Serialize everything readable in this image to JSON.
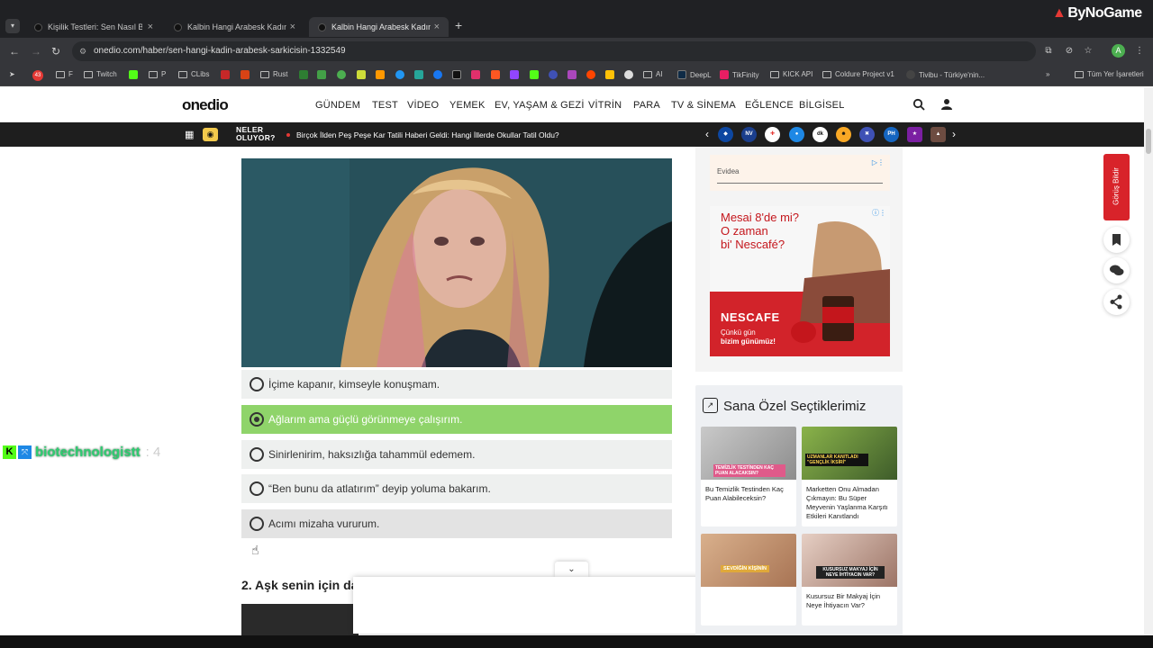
{
  "browser": {
    "tabs": [
      {
        "title": "Kişilik Testleri: Sen Nasıl Birisin?"
      },
      {
        "title": "Kalbin Hangi Arabesk Kadın Şa"
      },
      {
        "title": "Kalbin Hangi Arabesk Kadın Şa"
      }
    ],
    "url": "onedio.com/haber/sen-hangi-kadin-arabesk-sarkicisin-1332549",
    "avatar_letter": "A",
    "brand_overlay": "ByNoGame",
    "bookmarks": [
      "F",
      "Twitch",
      "P",
      "CLibs",
      "Rust",
      "AI",
      "DeepL",
      "TikFinity",
      "KICK API",
      "Coldure Project v1",
      "Tivibu - Türkiye'nin...",
      "Tüm Yer İşaretleri"
    ],
    "bookmark_badge": "43"
  },
  "site": {
    "logo": "onedio",
    "nav": [
      "GÜNDEM",
      "TEST",
      "VİDEO",
      "YEMEK",
      "EV, YAŞAM & GEZİ",
      "VİTRİN",
      "PARA",
      "TV & SİNEMA",
      "EĞLENCE",
      "BİLGİSEL"
    ],
    "news_label_line1": "NELER",
    "news_label_line2": "OLUYOR?",
    "news_headline": "Birçok İlden Peş Peşe Kar Tatili Haberi Geldi: Hangi İllerde Okullar Tatil Oldu?"
  },
  "quiz": {
    "options": [
      {
        "text": "İçime kapanır, kimseyle konuşmam.",
        "selected": false
      },
      {
        "text": "Ağlarım ama güçlü görünmeye çalışırım.",
        "selected": true
      },
      {
        "text": "Sinirlenirim, haksızlığa tahammül edemem.",
        "selected": false
      },
      {
        "text": "“Ben bunu da atlatırım” deyip yoluma bakarım.",
        "selected": false
      },
      {
        "text": "Acımı mizaha vururum.",
        "selected": false
      }
    ],
    "next_question": "2. Aşk senin için da"
  },
  "sidebar": {
    "ad_top_label": "Evidea",
    "ad_nescafe": {
      "line1": "Mesai 8'de mi?",
      "line2": "O zaman",
      "line3": "bi' Nescafé?",
      "brand": "NESCAFE",
      "tag1": "Çünkü gün",
      "tag2": "bizim günümüz!"
    },
    "picks_title": "Sana Özel Seçtiklerimiz",
    "cards": [
      {
        "caption": "Bu Temizlik Testinden Kaç Puan Alabileceksin?",
        "img_label": "TEMİZLİK TESTİNDEN KAÇ PUAN ALACAKSIN?"
      },
      {
        "caption": "Marketten Onu Almadan Çıkmayın: Bu Süper Meyvenin Yaşlanma Karşıtı Etkileri Kanıtlandı",
        "img_label": "UZMANLAR KANITLADI \"GENÇLİK İKSİRİ\""
      },
      {
        "caption": "",
        "img_label": "SEVDİĞİN KİŞİNİN"
      },
      {
        "caption": "Kusursuz Bir Makyaj İçin Neye İhtiyacın Var?",
        "img_label": "KUSURSUZ MAKYAJ İÇİN NEYE İHTİYACIN VAR?"
      }
    ]
  },
  "floating": {
    "feedback": "Görüş Bildir"
  },
  "overlay": {
    "username": "biotechnologistt",
    "count": ": 4"
  },
  "colors": {
    "selected_option": "#8fd46a",
    "feedback_red": "#d8232a",
    "newsbar": "#1e1e1e"
  }
}
